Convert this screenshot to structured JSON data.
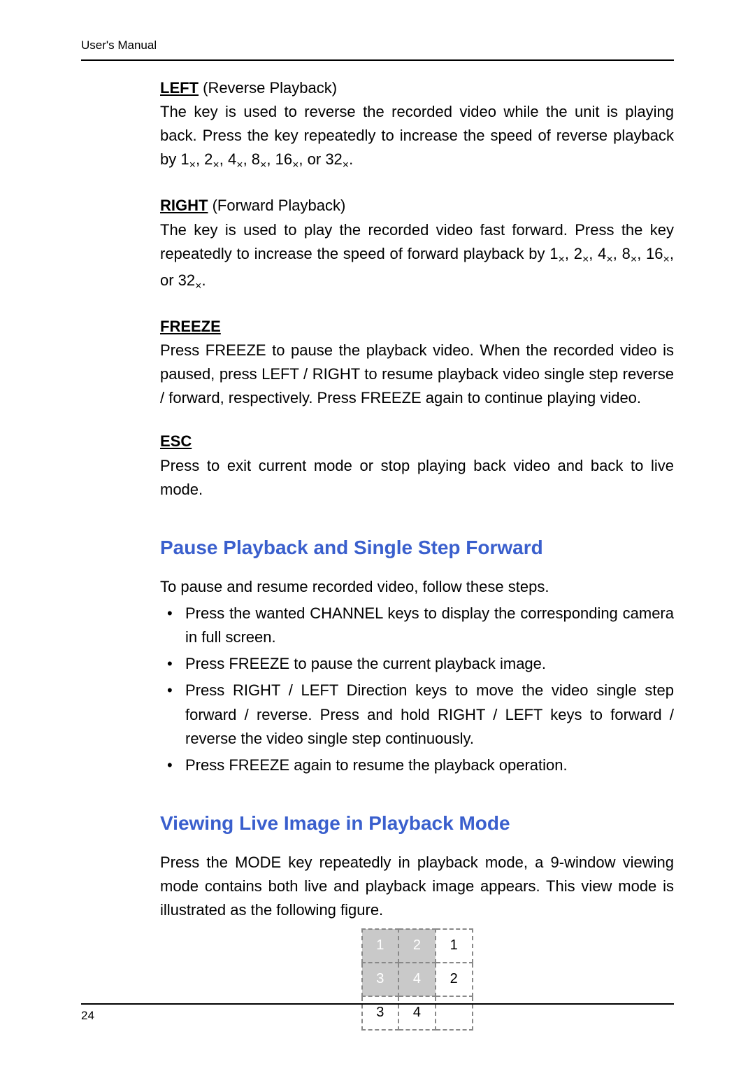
{
  "running_head": "User's Manual",
  "page_number": "24",
  "left": {
    "title": "LEFT",
    "suffix": " (Reverse Playback)",
    "body_a": "The key is used to reverse the recorded video while the unit is playing back. Press the key repeatedly to increase the speed of reverse playback by 1",
    "x1": "×",
    "body_b": ", 2",
    "x2": "×",
    "body_c": ", 4",
    "x3": "×",
    "body_d": ", 8",
    "x4": "×",
    "body_e": ", 16",
    "x5": "×",
    "body_f": ", or 32",
    "x6": "×",
    "body_g": "."
  },
  "right": {
    "title": "RIGHT",
    "suffix": " (Forward Playback)",
    "body_a": "The key is used to play the recorded video fast forward. Press the key repeatedly to increase the speed of forward playback by 1",
    "x1": "×",
    "body_b": ", 2",
    "x2": "×",
    "body_c": ", 4",
    "x3": "×",
    "body_d": ", 8",
    "x4": "×",
    "body_e": ", 16",
    "x5": "×",
    "body_f": ", or 32",
    "x6": "×",
    "body_g": "."
  },
  "freeze": {
    "title": "FREEZE",
    "body": "Press FREEZE to pause the playback video. When the recorded video is paused, press LEFT / RIGHT to resume playback video single step reverse / forward, respectively. Press FREEZE again to continue playing video."
  },
  "esc": {
    "title": "ESC",
    "body": "Press to exit current mode or stop playing back video and back to live mode."
  },
  "section_pause": {
    "heading": "Pause Playback and Single Step Forward",
    "intro": "To pause and resume recorded video, follow these steps.",
    "bullets": [
      "Press the wanted CHANNEL keys to display the corresponding camera in full screen.",
      "Press FREEZE to pause the current playback image.",
      "Press RIGHT / LEFT Direction keys to move the video single step forward / reverse. Press and hold RIGHT / LEFT keys to forward / reverse the video single step continuously.",
      "Press FREEZE again to resume the playback operation."
    ]
  },
  "section_live": {
    "heading": "Viewing Live Image in Playback Mode",
    "intro": "Press the MODE key repeatedly in playback mode, a 9-window viewing mode contains both live and playback image appears. This view mode is illustrated as the following figure."
  },
  "grid": {
    "r0c0": "1",
    "r0c1": "2",
    "r0c2": "1",
    "r1c0": "3",
    "r1c1": "4",
    "r1c2": "2",
    "r2c0": "3",
    "r2c1": "4"
  }
}
